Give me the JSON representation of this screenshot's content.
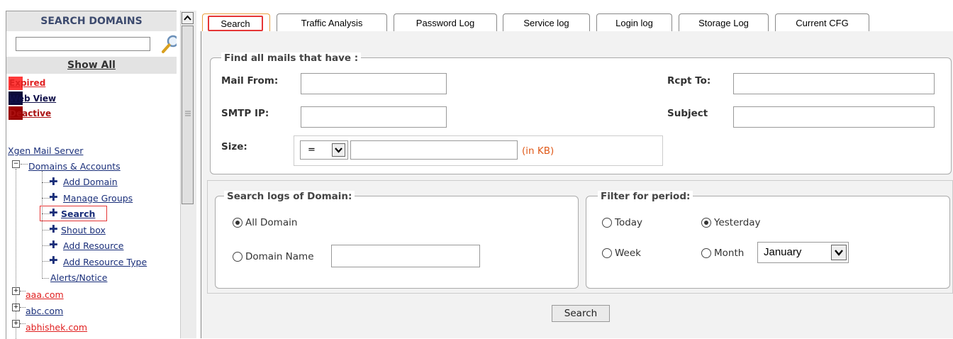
{
  "sidebar": {
    "title": "SEARCH DOMAINS",
    "search_placeholder": "",
    "show_all": "Show All",
    "legend": [
      {
        "label": "Expired",
        "color": "#ff3b3b",
        "text_color": "#e02020"
      },
      {
        "label": "Web View",
        "color": "#0b0b3a",
        "text_color": "#10104a"
      },
      {
        "label": "Deactive",
        "color": "#990000",
        "text_color": "#aa1010"
      }
    ],
    "root": "Xgen Mail Server",
    "group": "Domains & Accounts",
    "items": [
      "Add Domain",
      "Manage Groups",
      "Search",
      "Shout box",
      "Add Resource",
      "Add Resource Type",
      "Alerts/Notice"
    ],
    "domains": [
      "aaa.com",
      "abc.com",
      "abhishek.com"
    ],
    "domain_colors": [
      "#e02020",
      "#1a2f7a",
      "#e02020"
    ]
  },
  "tabs": [
    "Search",
    "Traffic Analysis",
    "Password Log",
    "Service log",
    "Login log",
    "Storage Log",
    "Current CFG"
  ],
  "active_tab": 0,
  "mail_filter": {
    "legend": "Find all mails that have :",
    "mail_from_label": "Mail From:",
    "mail_from_value": "",
    "rcpt_to_label": "Rcpt To:",
    "rcpt_to_value": "",
    "smtp_ip_label": "SMTP IP:",
    "smtp_ip_value": "",
    "subject_label": "Subject",
    "subject_value": "",
    "size_label": "Size:",
    "size_operator": "=",
    "size_value": "",
    "size_unit": "(in KB)"
  },
  "domain_logs": {
    "legend": "Search logs of Domain:",
    "all_domain": "All Domain",
    "domain_name": "Domain Name",
    "domain_name_value": "",
    "selected": "all_domain"
  },
  "period": {
    "legend": "Filter for period:",
    "today": "Today",
    "yesterday": "Yesterday",
    "week": "Week",
    "month": "Month",
    "month_value": "January",
    "selected": "yesterday"
  },
  "search_button": "Search",
  "colors": {
    "accent_red": "#e53636",
    "unit_orange": "#e05a1a",
    "link_blue": "#1a2f7a"
  }
}
